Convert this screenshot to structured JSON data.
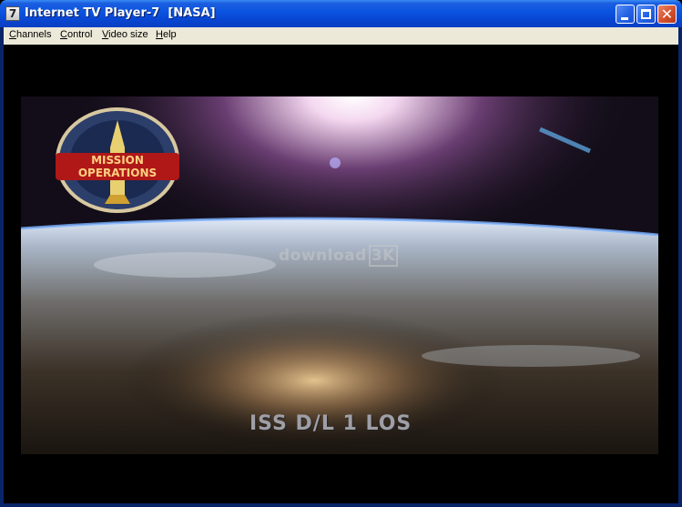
{
  "window": {
    "app_icon_glyph": "7",
    "title": "Internet TV Player-7  [NASA]",
    "controls": {
      "minimize_icon": "minimize-icon",
      "maximize_icon": "maximize-icon",
      "close_glyph": "✕"
    }
  },
  "menubar": {
    "items": [
      {
        "underline": "C",
        "rest": "hannels"
      },
      {
        "underline": "C",
        "rest": "ontrol"
      },
      {
        "underline": "V",
        "rest": "ideo size"
      },
      {
        "underline": "H",
        "rest": "elp"
      }
    ]
  },
  "video": {
    "patch_label": "MISSION OPERATIONS",
    "watermark_text": "download",
    "watermark_box": "3K",
    "caption": "ISS D/L 1 LOS"
  }
}
